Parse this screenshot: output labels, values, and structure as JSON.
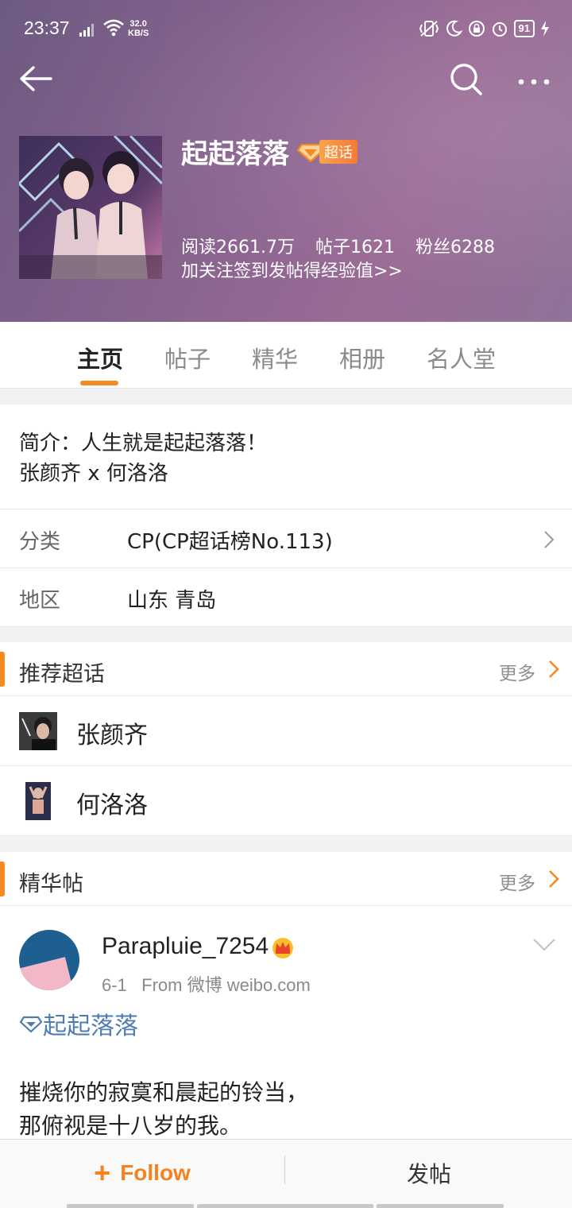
{
  "status_bar": {
    "time": "23:37",
    "net_speed_value": "32.0",
    "net_speed_unit": "KB/S",
    "battery": "91"
  },
  "header": {
    "title": "起起落落",
    "badge_label": "超话",
    "stats": {
      "reads": "阅读2661.7万",
      "posts": "帖子1621",
      "fans": "粉丝6288"
    },
    "cta": "加关注签到发帖得经验值>>"
  },
  "tabs": [
    {
      "label": "主页",
      "active": true
    },
    {
      "label": "帖子",
      "active": false
    },
    {
      "label": "精华",
      "active": false
    },
    {
      "label": "相册",
      "active": false
    },
    {
      "label": "名人堂",
      "active": false
    }
  ],
  "intro": {
    "line1": "简介：人生就是起起落落！",
    "line2": "张颜齐 x 何洛洛"
  },
  "info": {
    "category": {
      "key": "分类",
      "value": "CP(CP超话榜No.113)"
    },
    "region": {
      "key": "地区",
      "value": "山东 青岛"
    }
  },
  "recommended": {
    "title": "推荐超话",
    "more": "更多",
    "items": [
      {
        "name": "张颜齐"
      },
      {
        "name": "何洛洛"
      }
    ]
  },
  "featured": {
    "title": "精华帖",
    "more": "更多"
  },
  "post": {
    "username": "Parapluie_7254",
    "date": "6-1",
    "source": "From 微博 weibo.com",
    "topic": "起起落落",
    "line1": "摧烧你的寂寞和晨起的铃当，",
    "line2": "那俯视是十八岁的我。"
  },
  "bottom_bar": {
    "follow_label": "Follow",
    "publish_label": "发帖"
  },
  "colors": {
    "accent": "#f58a22",
    "topic_link": "#507daf",
    "header_bg": "#8a6590"
  }
}
